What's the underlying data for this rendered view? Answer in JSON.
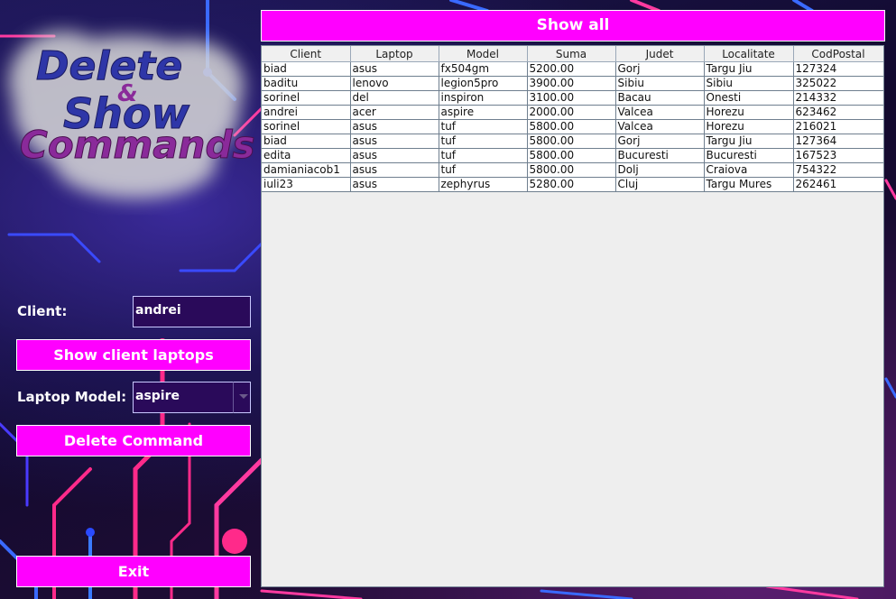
{
  "window": {
    "logo_text": [
      "Delete",
      "&",
      "Show",
      "Commands"
    ]
  },
  "form": {
    "client_label": "Client:",
    "client_value": "andrei",
    "show_client_laptops_label": "Show client laptops",
    "laptop_model_label": "Laptop Model:",
    "laptop_model_value": "aspire",
    "delete_command_label": "Delete Command",
    "exit_label": "Exit"
  },
  "toolbar": {
    "show_all_label": "Show all"
  },
  "table": {
    "columns": [
      "Client",
      "Laptop",
      "Model",
      "Suma",
      "Judet",
      "Localitate",
      "CodPostal"
    ],
    "rows": [
      [
        "biad",
        "asus",
        "fx504gm",
        "5200.00",
        "Gorj",
        "Targu Jiu",
        "127324"
      ],
      [
        "baditu",
        "lenovo",
        "legion5pro",
        "3900.00",
        "Sibiu",
        "Sibiu",
        "325022"
      ],
      [
        "sorinel",
        "del",
        "inspiron",
        "3100.00",
        "Bacau",
        "Onesti",
        "214332"
      ],
      [
        "andrei",
        "acer",
        "aspire",
        "2000.00",
        "Valcea",
        "Horezu",
        "623462"
      ],
      [
        "sorinel",
        "asus",
        "tuf",
        "5800.00",
        "Valcea",
        "Horezu",
        "216021"
      ],
      [
        "biad",
        "asus",
        "tuf",
        "5800.00",
        "Gorj",
        "Targu Jiu",
        "127364"
      ],
      [
        "edita",
        "asus",
        "tuf",
        "5800.00",
        "Bucuresti",
        "Bucuresti",
        "167523"
      ],
      [
        "damianiacob1",
        "asus",
        "tuf",
        "5800.00",
        "Dolj",
        "Craiova",
        "754322"
      ],
      [
        "iuli23",
        "asus",
        "zephyrus",
        "5280.00",
        "Cluj",
        "Targu Mures",
        "262461"
      ]
    ]
  },
  "colors": {
    "accent": "#ff00ff",
    "field_bg": "#2a0a5a",
    "logo_blue": "#2e36a8",
    "logo_purple": "#8a2a9a"
  }
}
